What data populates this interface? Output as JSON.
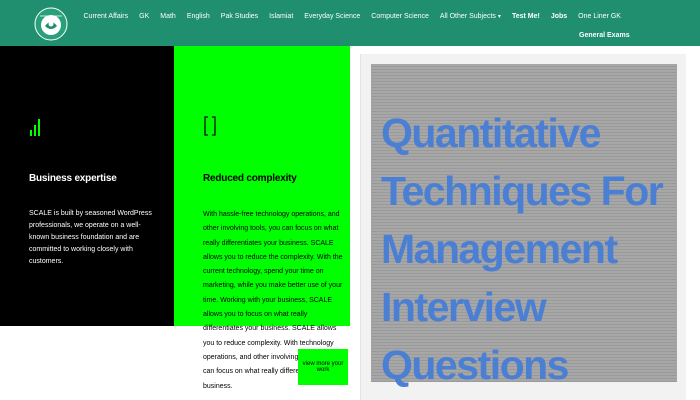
{
  "navbar": {
    "items": [
      {
        "label": "Current Affairs"
      },
      {
        "label": "GK"
      },
      {
        "label": "Math"
      },
      {
        "label": "English"
      },
      {
        "label": "Pak Studies"
      },
      {
        "label": "Islamiat"
      },
      {
        "label": "Everyday Science"
      },
      {
        "label": "Computer Science"
      },
      {
        "label": "All Other Subjects"
      },
      {
        "label": "Test Me!"
      },
      {
        "label": "Jobs"
      },
      {
        "label": "One Liner GK"
      }
    ],
    "second_row": "General Exams",
    "logo_icon": "site-logo-icon",
    "bg_color": "#1f8f6f"
  },
  "features": {
    "black_panel": {
      "icon": "bar-chart-icon",
      "heading": "Business expertise",
      "body": "SCALE is built by seasoned WordPress professionals, we operate on a well-known business foundation and are committed to working closely with customers."
    },
    "green_panel": {
      "icon": "bracket-icon",
      "heading": "Reduced complexity",
      "body": "With hassle-free technology operations, and other involving tools, you can focus on what really differentiates your business. SCALE allows you to reduce the complexity. With the current technology, spend your time on marketing, while you make better use of your time. Working with your business, SCALE allows you to focus on what really differentiates your business. SCALE allows you to reduce complexity. With technology operations, and other involving tools, you can focus on what really differentiates your business."
    },
    "green_button_label": "view more your work"
  },
  "card": {
    "title": "Quantitative Techniques For Management Interview Questions"
  }
}
